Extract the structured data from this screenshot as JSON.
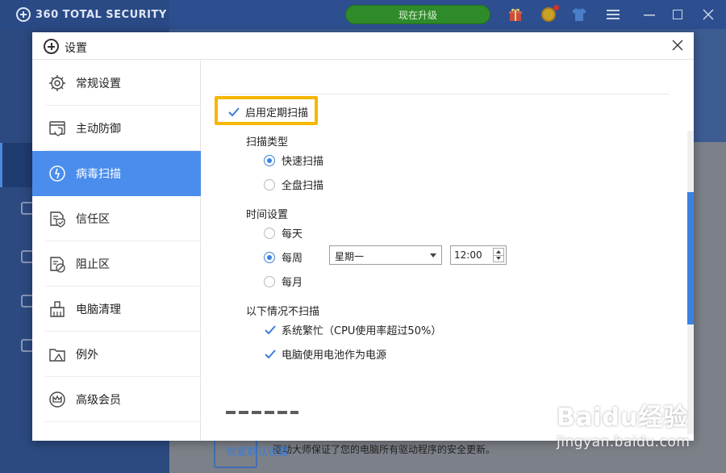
{
  "app": {
    "title": "360 TOTAL SECURITY",
    "upgrade_label": "现在升级",
    "bottom_text": "驱动大师保证了您的电脑所有驱动程序的安全更新。"
  },
  "dialog": {
    "title": "设置",
    "nav": [
      {
        "label": "常规设置",
        "icon": "gear-icon",
        "active": false
      },
      {
        "label": "主动防御",
        "icon": "shield-window-icon",
        "active": false
      },
      {
        "label": "病毒扫描",
        "icon": "scan-icon",
        "active": true
      },
      {
        "label": "信任区",
        "icon": "trust-shield-icon",
        "active": false
      },
      {
        "label": "阻止区",
        "icon": "block-icon",
        "active": false
      },
      {
        "label": "电脑清理",
        "icon": "broom-icon",
        "active": false
      },
      {
        "label": "例外",
        "icon": "folder-exception-icon",
        "active": false
      },
      {
        "label": "高级会员",
        "icon": "crown-icon",
        "active": false
      }
    ],
    "content": {
      "enable_scheduled_scan": {
        "label": "启用定期扫描",
        "checked": true
      },
      "scan_type": {
        "label": "扫描类型",
        "options": [
          {
            "label": "快速扫描",
            "selected": true
          },
          {
            "label": "全盘扫描",
            "selected": false
          }
        ]
      },
      "time_settings": {
        "label": "时间设置",
        "options": [
          {
            "label": "每天",
            "selected": false
          },
          {
            "label": "每周",
            "selected": true
          },
          {
            "label": "每月",
            "selected": false
          }
        ],
        "weekday": "星期一",
        "time": "12:00"
      },
      "skip_conditions": {
        "label": "以下情况不扫描",
        "items": [
          {
            "label": "系统繁忙（CPU使用率超过50%）",
            "checked": true
          },
          {
            "label": "电脑使用电池作为电源",
            "checked": true
          }
        ]
      },
      "restore_defaults": "恢复默认设置"
    }
  },
  "watermark": {
    "brand": "Baidu经验",
    "url": "jingyan.baidu.com"
  },
  "colors": {
    "accent": "#4a8ded",
    "highlight": "#f5b700",
    "link": "#3b7dd8",
    "upgrade": "#2f8a2a"
  }
}
